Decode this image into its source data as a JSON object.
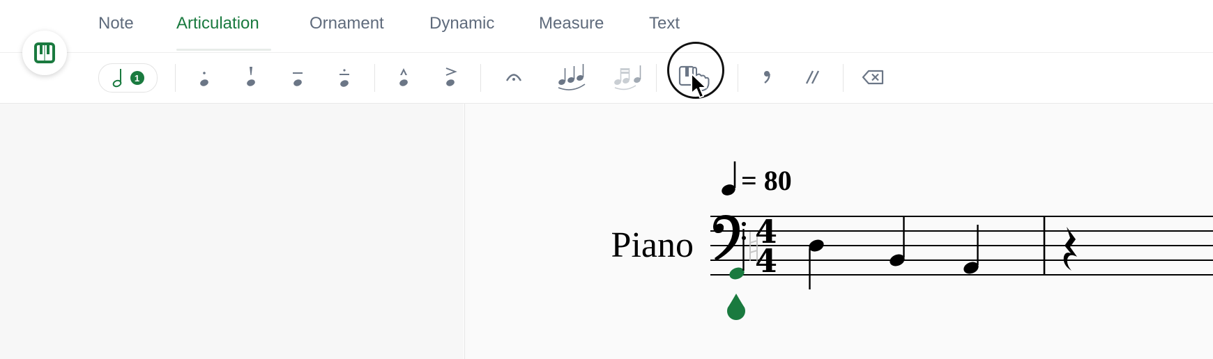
{
  "tabs": [
    {
      "label": "Note"
    },
    {
      "label": "Articulation"
    },
    {
      "label": "Ornament"
    },
    {
      "label": "Dynamic"
    },
    {
      "label": "Measure"
    },
    {
      "label": "Text"
    }
  ],
  "active_tab": "Articulation",
  "colors": {
    "accent": "#1a7a3f",
    "text_muted": "#5f6b7c",
    "icon": "#6b7686"
  },
  "toolbar": {
    "voice_badge": "1",
    "tools": [
      {
        "icon": "staccato-icon"
      },
      {
        "icon": "staccatissimo-icon"
      },
      {
        "icon": "tenuto-icon"
      },
      {
        "icon": "portato-icon"
      },
      {
        "icon": "marcato-icon"
      },
      {
        "icon": "accent-icon"
      },
      {
        "icon": "fermata-icon"
      },
      {
        "icon": "slur-icon"
      },
      {
        "icon": "tie-icon"
      },
      {
        "icon": "arpeggio-touch-icon"
      },
      {
        "icon": "breath-mark-icon"
      },
      {
        "icon": "caesura-icon"
      },
      {
        "icon": "delete-icon"
      }
    ]
  },
  "score": {
    "tempo_value": "= 80",
    "instrument": "Piano",
    "time_signature": {
      "top": "4",
      "bottom": "4"
    }
  }
}
